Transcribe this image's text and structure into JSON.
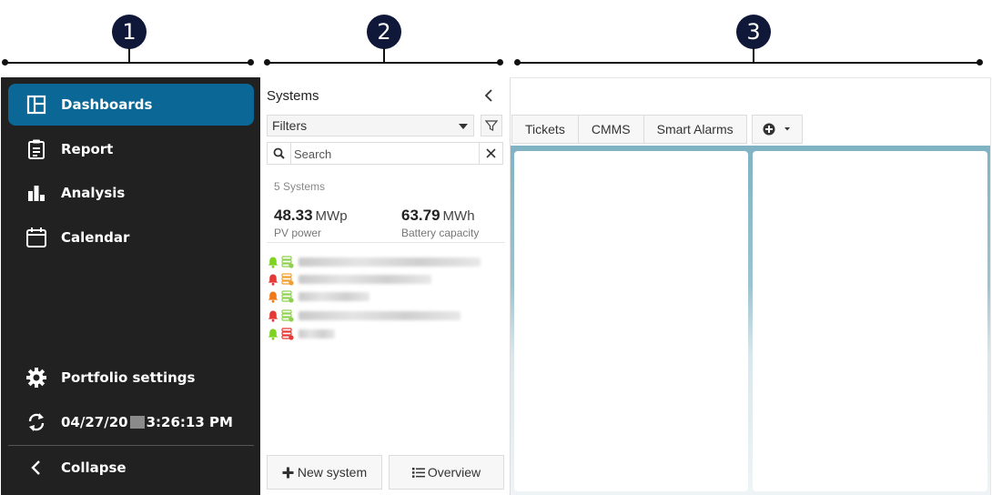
{
  "callouts": [
    "1",
    "2",
    "3"
  ],
  "sidebar": {
    "items": [
      {
        "label": "Dashboards",
        "icon": "dashboard-icon",
        "active": true
      },
      {
        "label": "Report",
        "icon": "report-icon",
        "active": false
      },
      {
        "label": "Analysis",
        "icon": "bar-chart-icon",
        "active": false
      },
      {
        "label": "Calendar",
        "icon": "calendar-icon",
        "active": false
      }
    ],
    "portfolio_settings": "Portfolio settings",
    "timestamp_prefix": "04/27/20",
    "timestamp_suffix": "3:26:13 PM",
    "collapse": "Collapse"
  },
  "systems": {
    "title": "Systems",
    "filters_label": "Filters",
    "search_placeholder": "Search",
    "count_text": "5 Systems",
    "pv_power": {
      "value": "48.33",
      "unit": "MWp",
      "label": "PV power"
    },
    "battery": {
      "value": "63.79",
      "unit": "MWh",
      "label": "Battery capacity"
    },
    "rows": [
      {
        "alarm_color": "#7ed321",
        "status_color": "#8fd14f"
      },
      {
        "alarm_color": "#e53935",
        "status_color": "#f0a030"
      },
      {
        "alarm_color": "#f07a1a",
        "status_color": "#8fd14f"
      },
      {
        "alarm_color": "#e53935",
        "status_color": "#8fd14f"
      },
      {
        "alarm_color": "#7ed321",
        "status_color": "#e53935"
      }
    ],
    "new_system": "New system",
    "overview": "Overview"
  },
  "main": {
    "tabs": [
      "Tickets",
      "CMMS",
      "Smart Alarms"
    ]
  },
  "colors": {
    "sidebar_bg": "#212121",
    "active_item": "#0a6796",
    "callout": "#0f1838"
  }
}
